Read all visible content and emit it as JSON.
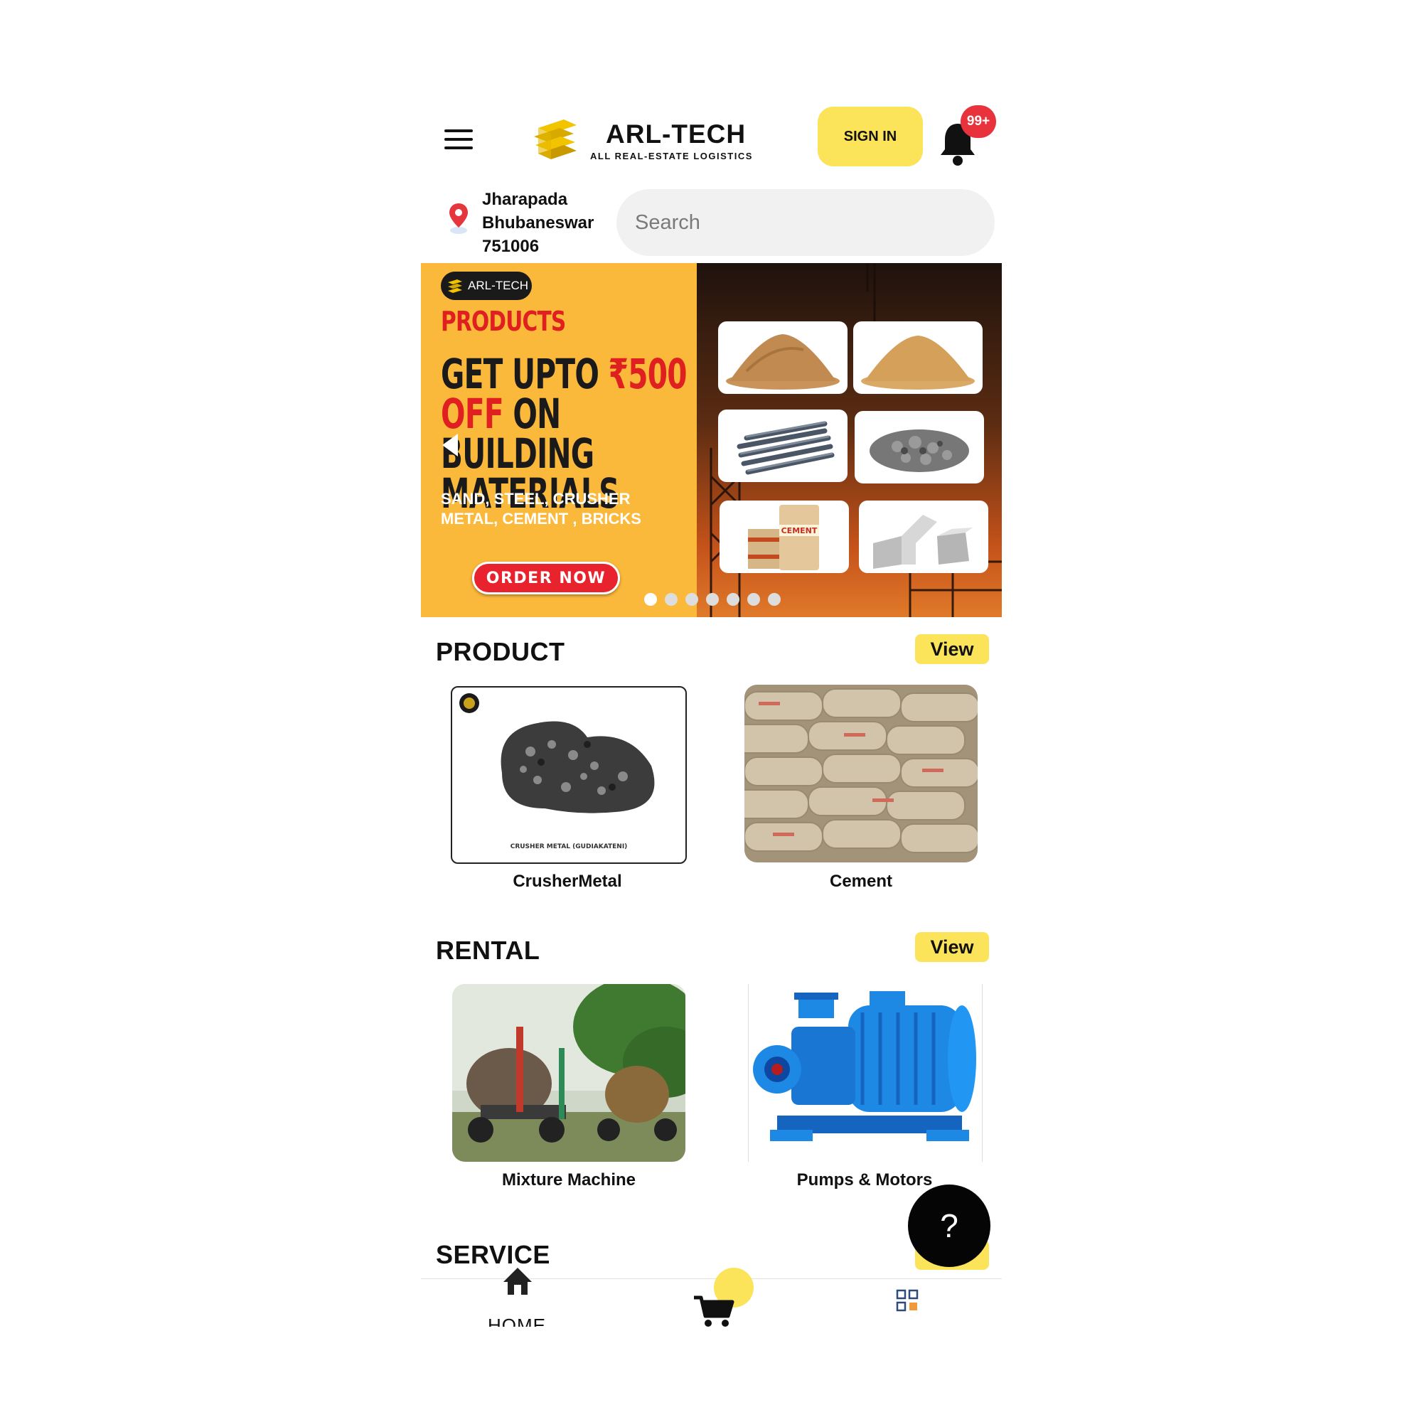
{
  "header": {
    "logo_title": "ARL-TECH",
    "logo_subtitle": "ALL REAL-ESTATE LOGISTICS",
    "signin_label": "SIGN IN",
    "notification_badge": "99+"
  },
  "location": {
    "line1": "Jharapada",
    "line2": "Bhubaneswar",
    "line3": "751006"
  },
  "search": {
    "placeholder": "Search"
  },
  "banner": {
    "brand_tag": "ARL-TECH",
    "category": "PRODUCTS",
    "headline_part1": "GET UPTO ",
    "headline_amount": "₹500",
    "headline_off": "OFF",
    "headline_part2": " ON BUILDING MATERIALS",
    "subtitle": "SAND, STEEL, CRUSHER METAL, CEMENT , BRICKS",
    "cta_label": "ORDER NOW",
    "cement_bag_text": "CEMENT",
    "dot_count": 7,
    "active_dot": 1
  },
  "sections": {
    "product": {
      "title": "PRODUCT",
      "view_label": "View",
      "items": [
        {
          "label": "CrusherMetal",
          "image_caption": "CRUSHER METAL (GUDIAKATENI)"
        },
        {
          "label": "Cement"
        }
      ]
    },
    "rental": {
      "title": "RENTAL",
      "view_label": "View",
      "items": [
        {
          "label": "Mixture Machine"
        },
        {
          "label": "Pumps & Motors"
        }
      ]
    },
    "service": {
      "title": "SERVICE"
    }
  },
  "help_button": {
    "label": "?"
  },
  "bottom_nav": {
    "home_label": "HOME"
  },
  "colors": {
    "accent_yellow": "#fbe45a",
    "banner_orange": "#fbb93c",
    "badge_red": "#e8323c",
    "cta_red": "#e8232d"
  }
}
